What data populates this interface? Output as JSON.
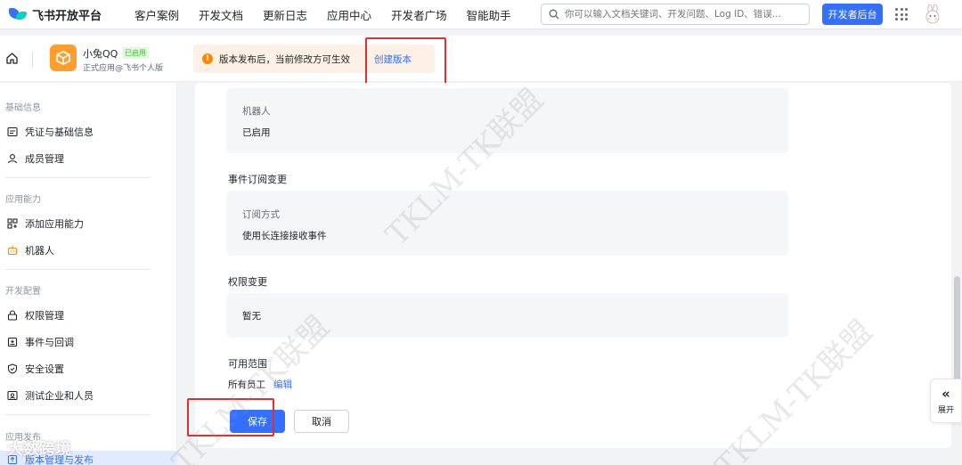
{
  "topbar": {
    "brand": "飞书开放平台",
    "nav": [
      "客户案例",
      "开发文档",
      "更新日志",
      "应用中心",
      "开发者广场",
      "智能助手"
    ],
    "search_placeholder": "你可以输入文档关键词、开发问题、Log ID、错误...",
    "dev_console": "开发者后台"
  },
  "app": {
    "name": "小兔QQ",
    "badge": "已启用",
    "subtitle": "正式应用@飞书个人版",
    "notice": "版本发布后，当前修改方可生效",
    "create_version": "创建版本"
  },
  "sidebar": {
    "sections": [
      "基础信息",
      "应用能力",
      "开发配置",
      "应用发布"
    ],
    "items": [
      {
        "label": "凭证与基础信息",
        "icon": "credential-icon"
      },
      {
        "label": "成员管理",
        "icon": "user-icon"
      },
      {
        "label": "添加应用能力",
        "icon": "apps-add-icon"
      },
      {
        "label": "机器人",
        "icon": "robot-icon"
      },
      {
        "label": "权限管理",
        "icon": "lock-icon"
      },
      {
        "label": "事件与回调",
        "icon": "event-icon"
      },
      {
        "label": "安全设置",
        "icon": "shield-icon"
      },
      {
        "label": "测试企业和人员",
        "icon": "test-icon"
      },
      {
        "label": "版本管理与发布",
        "icon": "version-icon"
      }
    ]
  },
  "main": {
    "robot": {
      "label": "机器人",
      "value": "已启用"
    },
    "event_title": "事件订阅变更",
    "event": {
      "label": "订阅方式",
      "value": "使用长连接接收事件"
    },
    "permission_title": "权限变更",
    "permission": {
      "value": "暂无"
    },
    "scope_title": "可用范围",
    "scope_value": "所有员工",
    "scope_edit": "编辑",
    "save": "保存",
    "cancel": "取消"
  },
  "expand": {
    "label": "展开"
  },
  "watermark": {
    "text": "TKLM-TK联盟",
    "logo_text": "大数跨境"
  },
  "colors": {
    "primary": "#3370ff",
    "notice_bg": "#fdf0e4",
    "highlight": "#e03030"
  }
}
